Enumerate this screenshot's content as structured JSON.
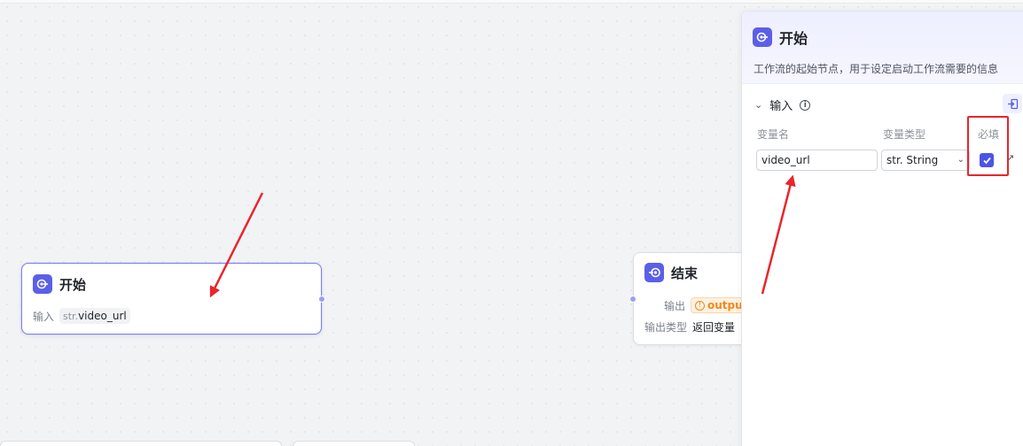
{
  "colors": {
    "accent": "#5b5fe8",
    "annotation_red": "#e8252b",
    "warning": "#ee8a1c"
  },
  "canvas": {
    "start_node": {
      "icon": "start-node-icon",
      "title": "开始",
      "input_label": "输入",
      "tag_prefix": "str.",
      "tag_name": "video_url"
    },
    "end_node": {
      "icon": "end-node-icon",
      "title": "结束",
      "output_label": "输出",
      "output_value": "output",
      "output_type_label": "输出类型",
      "output_type_value": "返回变量"
    }
  },
  "panel": {
    "icon": "start-node-icon",
    "title": "开始",
    "description": "工作流的起始节点，用于设定启动工作流需要的信息",
    "section": {
      "title": "输入",
      "info_icon": "info-icon",
      "import_icon": "import-icon"
    },
    "columns": {
      "name": "变量名",
      "type": "变量类型",
      "required": "必填"
    },
    "row": {
      "name_value": "video_url",
      "type_value": "str. String",
      "required": true
    }
  }
}
